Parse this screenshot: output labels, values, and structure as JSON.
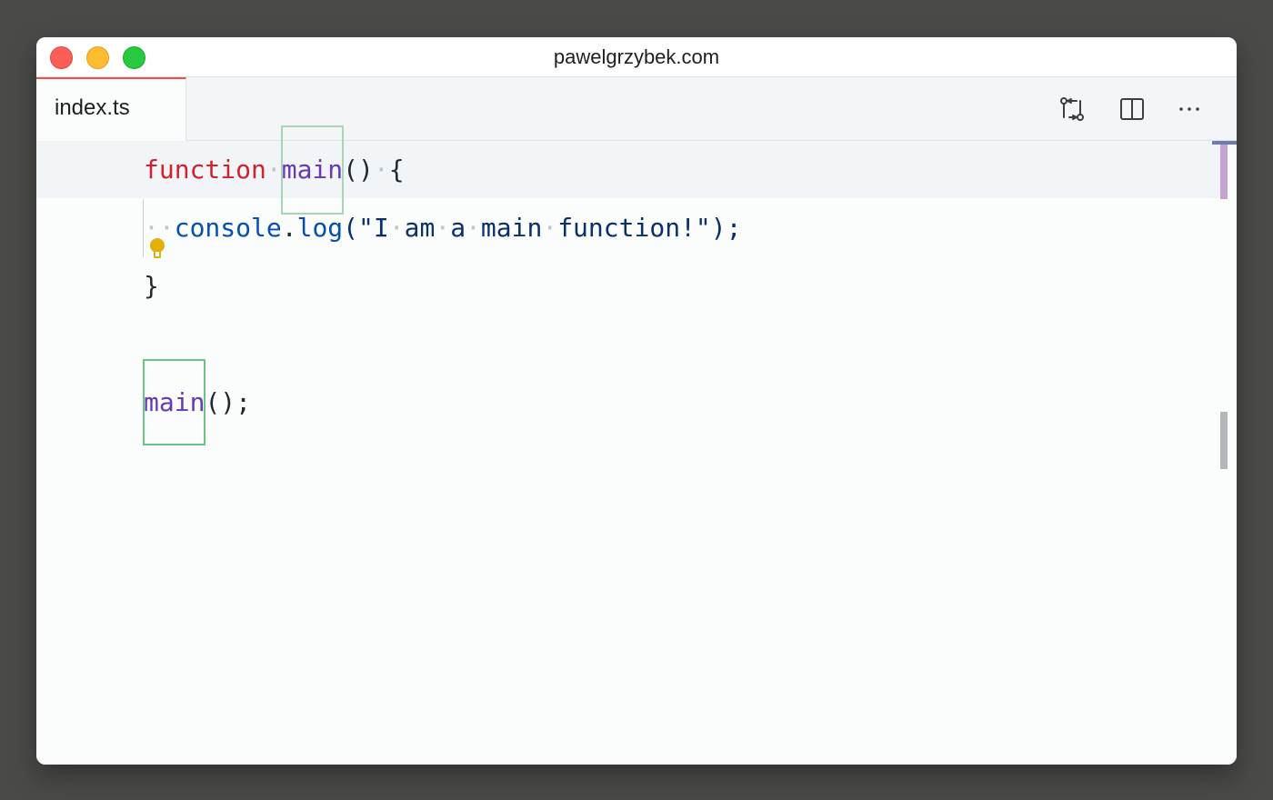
{
  "window": {
    "title": "pawelgrzybek.com"
  },
  "tabs": [
    {
      "label": "index.ts",
      "active": true
    }
  ],
  "toolbar": {
    "buttons": [
      {
        "name": "open-changes",
        "icon": "git-compare-icon"
      },
      {
        "name": "split-editor",
        "icon": "split-editor-icon"
      },
      {
        "name": "more-actions",
        "icon": "ellipsis-icon"
      }
    ]
  },
  "code": {
    "line1": {
      "keyword": "function",
      "sep1": "·",
      "name": "main",
      "parens": "()",
      "sep2": "·",
      "brace": "{"
    },
    "line2": {
      "indent": "··",
      "object": "console",
      "dot": ".",
      "method": "log",
      "open": "(\"",
      "w1": "I",
      "s1": "·",
      "w2": "am",
      "s2": "·",
      "w3": "a",
      "s3": "·",
      "w4": "main",
      "s4": "·",
      "w5": "function!",
      "close": "\");"
    },
    "line3": {
      "brace": "}"
    },
    "line5": {
      "name": "main",
      "call": "();"
    }
  },
  "colors": {
    "keyword": "#cf222e",
    "function_name": "#6639ba",
    "identifier": "#0550ae",
    "string": "#0a3069",
    "tab_accent": "#f14c4c",
    "highlight_border": "#a8d5b5",
    "lightbulb": "#e2b007"
  }
}
